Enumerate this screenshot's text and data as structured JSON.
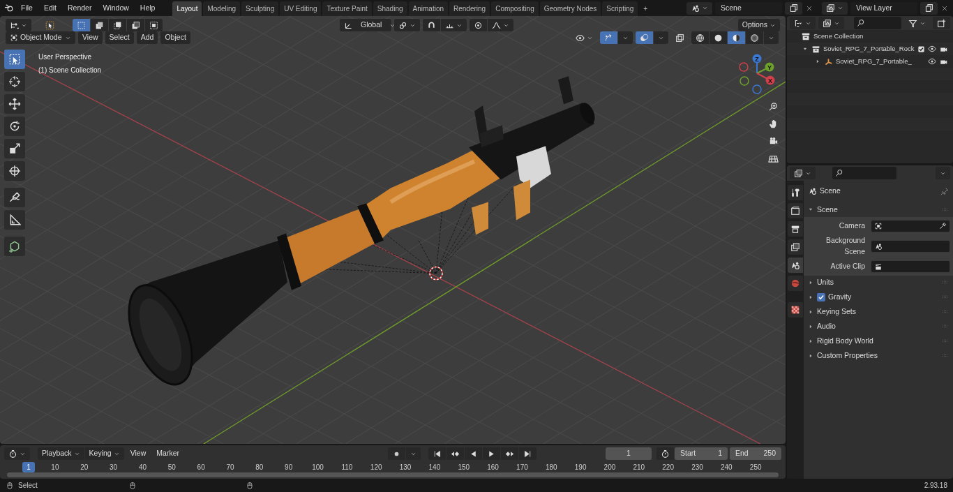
{
  "top_bar": {
    "menus": [
      "File",
      "Edit",
      "Render",
      "Window",
      "Help"
    ],
    "workspaces": [
      {
        "label": "Layout",
        "selected": true
      },
      {
        "label": "Modeling",
        "selected": false
      },
      {
        "label": "Sculpting",
        "selected": false
      },
      {
        "label": "UV Editing",
        "selected": false
      },
      {
        "label": "Texture Paint",
        "selected": false
      },
      {
        "label": "Shading",
        "selected": false
      },
      {
        "label": "Animation",
        "selected": false
      },
      {
        "label": "Rendering",
        "selected": false
      },
      {
        "label": "Compositing",
        "selected": false
      },
      {
        "label": "Geometry Nodes",
        "selected": false
      },
      {
        "label": "Scripting",
        "selected": false
      }
    ],
    "add_workspace": "+",
    "scene": "Scene",
    "view_layer": "View Layer"
  },
  "viewport": {
    "select_modes": [
      {
        "selected": true
      },
      {
        "selected": false
      },
      {
        "selected": false
      },
      {
        "selected": false
      },
      {
        "selected": false
      }
    ],
    "transform_orientation": "Global",
    "options": "Options",
    "mode": "Object Mode",
    "menus": [
      "View",
      "Select",
      "Add",
      "Object"
    ],
    "shading_modes": [
      {
        "selected": false
      },
      {
        "selected": false
      },
      {
        "selected": true
      },
      {
        "selected": false
      }
    ],
    "info": [
      "User Perspective",
      "(1) Scene Collection"
    ],
    "tools": [
      {
        "selected": true
      },
      {
        "selected": false
      },
      {
        "selected": false
      },
      {
        "selected": false
      },
      {
        "selected": false
      },
      {
        "selected": false
      },
      {
        "selected": false
      },
      {
        "selected": false
      },
      {
        "selected": false
      }
    ],
    "gizmo_axes": [
      "Z",
      "Y",
      "X"
    ]
  },
  "outliner": {
    "root": "Scene Collection",
    "items": [
      {
        "label": "Soviet_RPG_7_Portable_Rock",
        "expanded": true,
        "checked": true,
        "children": [
          {
            "label": "Soviet_RPG_7_Portable_",
            "expanded": false
          }
        ]
      }
    ]
  },
  "properties": {
    "tabs": [
      {
        "selected": false
      },
      {
        "selected": false
      },
      {
        "selected": false
      },
      {
        "selected": false
      },
      {
        "selected": true
      },
      {
        "selected": false
      },
      {
        "selected": false
      }
    ],
    "context": "Scene",
    "panels": [
      {
        "label": "Scene",
        "kind": "plain",
        "expanded": true,
        "fields": [
          {
            "label": "Camera"
          },
          {
            "label": "Background Scene"
          },
          {
            "label": "Active Clip"
          }
        ]
      },
      {
        "label": "Units",
        "kind": "plain",
        "expanded": false
      },
      {
        "label": "Gravity",
        "kind": "checkbox",
        "expanded": false,
        "checked": true
      },
      {
        "label": "Keying Sets",
        "kind": "plain",
        "expanded": false
      },
      {
        "label": "Audio",
        "kind": "plain",
        "expanded": false
      },
      {
        "label": "Rigid Body World",
        "kind": "plain",
        "expanded": false
      },
      {
        "label": "Custom Properties",
        "kind": "plain",
        "expanded": false
      }
    ]
  },
  "timeline": {
    "menus": [
      "Playback",
      "Keying",
      "View",
      "Marker"
    ],
    "current_frame": "1",
    "start_label": "Start",
    "start": "1",
    "end_label": "End",
    "end": "250",
    "playhead": "1",
    "ticks": [
      "10",
      "20",
      "30",
      "40",
      "50",
      "60",
      "70",
      "80",
      "90",
      "100",
      "110",
      "120",
      "130",
      "140",
      "150",
      "160",
      "170",
      "180",
      "190",
      "200",
      "210",
      "220",
      "230",
      "240",
      "250"
    ]
  },
  "status_bar": {
    "hint": "Select",
    "version": "2.93.18"
  }
}
